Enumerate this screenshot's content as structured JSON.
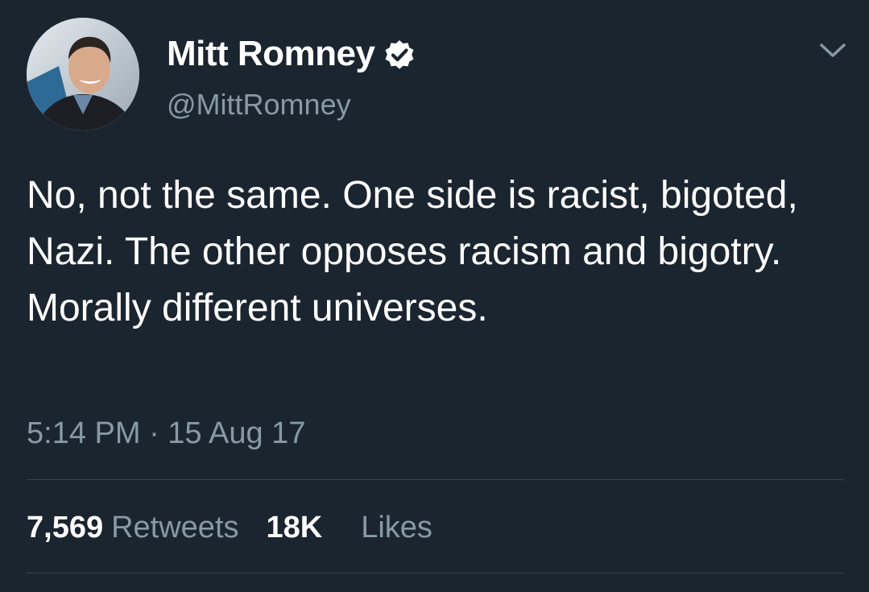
{
  "author": {
    "display_name": "Mitt Romney",
    "handle": "@MittRomney",
    "verified_icon": "verified-badge",
    "avatar_icon": "profile-photo"
  },
  "tweet": {
    "text": "No, not the same. One side is racist, bigoted, Nazi. The other opposes racism and bigotry. Morally different universes.",
    "timestamp": "5:14 PM · 15 Aug 17"
  },
  "stats": {
    "retweets_count": "7,569",
    "retweets_label": "Retweets",
    "likes_count": "18K",
    "likes_label": "Likes"
  },
  "menu": {
    "caret_icon": "chevron-down-icon"
  },
  "colors": {
    "background": "#1b2530",
    "primary_text": "#ffffff",
    "secondary_text": "#8899a6",
    "divider": "#38444d",
    "verified_badge": "#ffffff"
  }
}
